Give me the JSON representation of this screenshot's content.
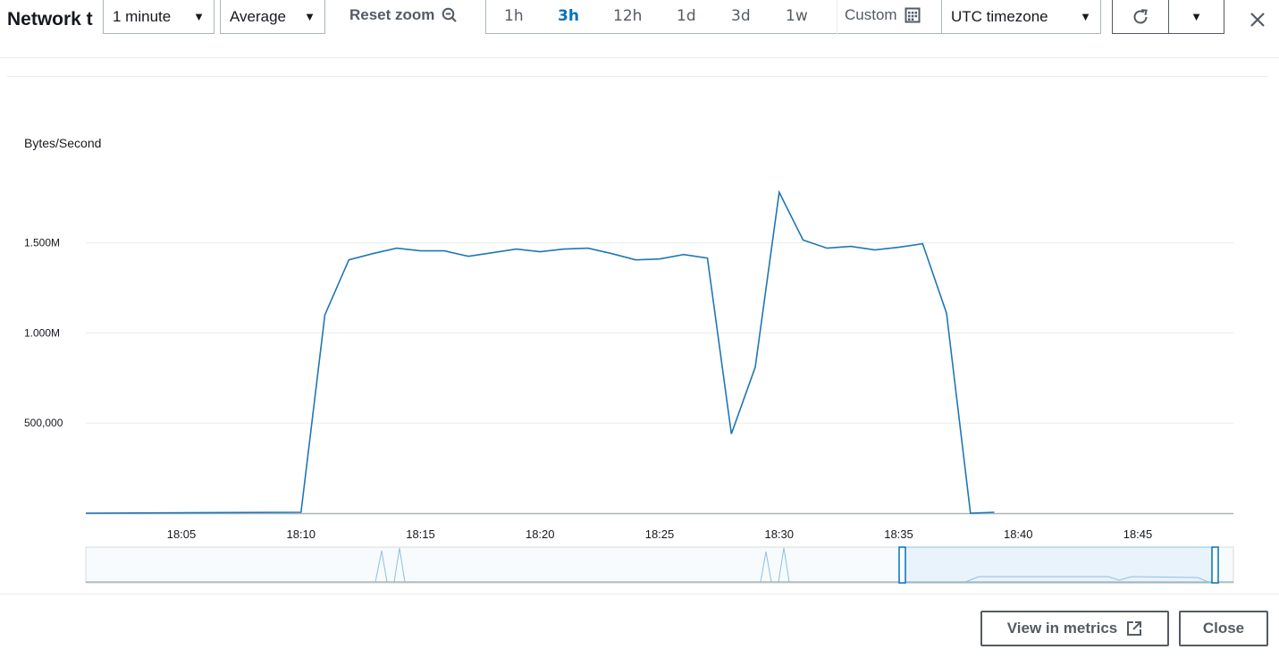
{
  "header": {
    "title": "Network t",
    "period": "1 minute",
    "statistic": "Average",
    "reset_zoom": "Reset zoom",
    "ranges": [
      "1h",
      "3h",
      "12h",
      "1d",
      "3d",
      "1w"
    ],
    "active_range": "3h",
    "custom": "Custom",
    "timezone": "UTC timezone"
  },
  "footer": {
    "view_in_metrics": "View in metrics",
    "close": "Close"
  },
  "colors": {
    "series": "#1f77b4",
    "accent": "#0073bb",
    "navigator_fill": "#e9f3fb"
  },
  "chart_data": {
    "type": "line",
    "ylabel": "Bytes/Second",
    "y_ticks": [
      {
        "value": 500000,
        "label": "500,000"
      },
      {
        "value": 1000000,
        "label": "1.000M"
      },
      {
        "value": 1500000,
        "label": "1.500M"
      }
    ],
    "ylim": [
      0,
      1850000
    ],
    "xlim": [
      "18:01",
      "18:49"
    ],
    "x_ticks": [
      "18:05",
      "18:10",
      "18:15",
      "18:20",
      "18:25",
      "18:30",
      "18:35",
      "18:40",
      "18:45"
    ],
    "grid": true,
    "series": [
      {
        "points": [
          [
            "18:01",
            0
          ],
          [
            "18:10",
            5000
          ],
          [
            "18:11",
            1100000
          ],
          [
            "18:12",
            1405000
          ],
          [
            "18:13",
            1440000
          ],
          [
            "18:14",
            1470000
          ],
          [
            "18:15",
            1455000
          ],
          [
            "18:16",
            1455000
          ],
          [
            "18:17",
            1425000
          ],
          [
            "18:18",
            1445000
          ],
          [
            "18:19",
            1465000
          ],
          [
            "18:20",
            1450000
          ],
          [
            "18:21",
            1465000
          ],
          [
            "18:22",
            1470000
          ],
          [
            "18:23",
            1440000
          ],
          [
            "18:24",
            1405000
          ],
          [
            "18:25",
            1410000
          ],
          [
            "18:26",
            1435000
          ],
          [
            "18:27",
            1415000
          ],
          [
            "18:28",
            440000
          ],
          [
            "18:29",
            810000
          ],
          [
            "18:30",
            1780000
          ],
          [
            "18:31",
            1515000
          ],
          [
            "18:32",
            1470000
          ],
          [
            "18:33",
            1480000
          ],
          [
            "18:34",
            1460000
          ],
          [
            "18:35",
            1475000
          ],
          [
            "18:36",
            1495000
          ],
          [
            "18:37",
            1110000
          ],
          [
            "18:38",
            0
          ],
          [
            "18:39",
            5000
          ]
        ]
      }
    ]
  }
}
